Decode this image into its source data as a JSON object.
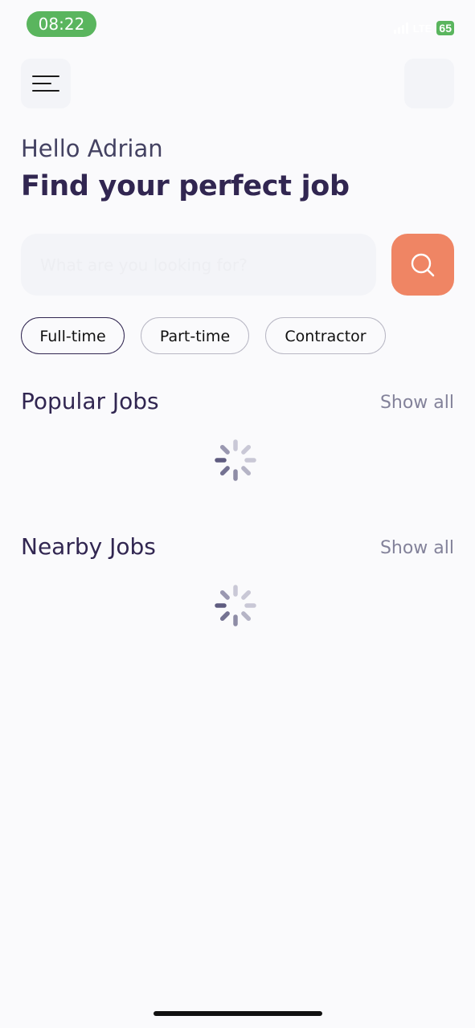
{
  "status_bar": {
    "time": "08:22",
    "network": "LTE",
    "battery": "65"
  },
  "header": {
    "menu_icon": "hamburger-menu-icon",
    "profile_icon": "profile-avatar"
  },
  "welcome": {
    "greeting": "Hello Adrian",
    "headline": "Find your perfect job"
  },
  "search": {
    "placeholder": "What are you looking for?",
    "value": "",
    "button_icon": "search-icon",
    "button_color": "#EF8564"
  },
  "job_types": [
    {
      "label": "Full-time",
      "selected": true
    },
    {
      "label": "Part-time",
      "selected": false
    },
    {
      "label": "Contractor",
      "selected": false
    }
  ],
  "sections": {
    "popular": {
      "title": "Popular Jobs",
      "show_all": "Show all",
      "loading": true
    },
    "nearby": {
      "title": "Nearby Jobs",
      "show_all": "Show all",
      "loading": true
    }
  },
  "colors": {
    "background": "#FAFAFC",
    "primary_text": "#312651",
    "secondary_text": "#83829A",
    "accent": "#EF8564",
    "status_green": "#5AB55E"
  }
}
